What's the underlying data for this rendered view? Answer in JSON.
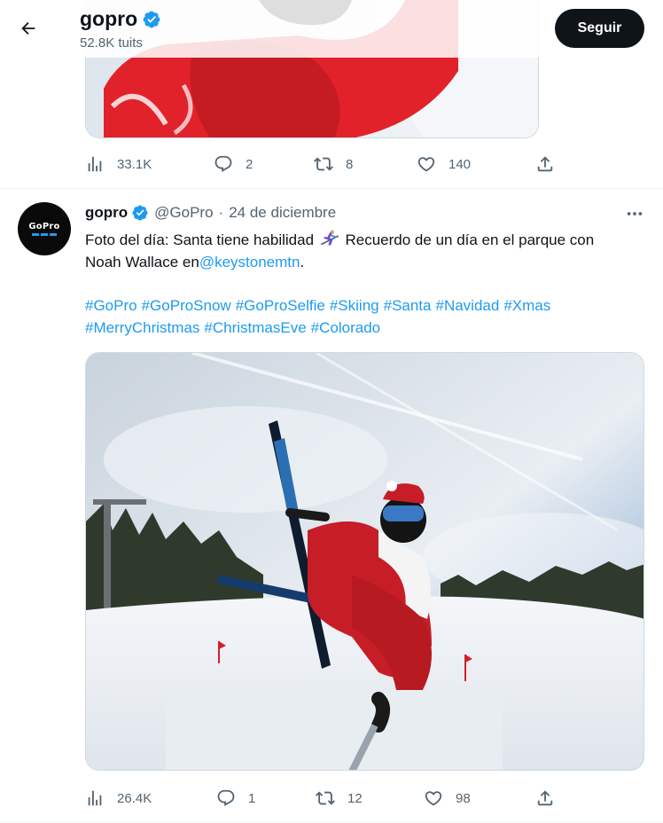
{
  "header": {
    "name": "gopro",
    "tweet_count": "52.8K tuits",
    "follow_label": "Seguir"
  },
  "prev_tweet": {
    "stats": {
      "views": "33.1K",
      "replies": "2",
      "retweets": "8",
      "likes": "140"
    }
  },
  "tweet": {
    "name": "gopro",
    "handle": "@GoPro",
    "separator": "·",
    "date": "24 de diciembre",
    "avatar_text": "GoPro",
    "text_part1": "Foto del día: Santa tiene habilidad",
    "text_part2": "Recuerdo de un día en el parque con",
    "text_part3": "Noah Wallace en",
    "mention": "@keystonemtn",
    "text_end": ".",
    "hashtags_row1": [
      "#GoPro",
      "#GoProSnow",
      "#GoProSelfie",
      "#Skiing",
      "#Santa",
      "#Navidad",
      "#Xmas"
    ],
    "hashtags_row2": [
      "#MerryChristmas",
      "#ChristmasEve",
      "#Colorado"
    ],
    "stats": {
      "views": "26.4K",
      "replies": "1",
      "retweets": "12",
      "likes": "98"
    }
  },
  "icons": {
    "back": "arrow-left-icon",
    "verified": "verified-badge-icon",
    "views": "bar-chart-icon",
    "reply": "speech-bubble-icon",
    "retweet": "retweet-icon",
    "like": "heart-icon",
    "share": "share-upload-icon",
    "more": "more-dots-icon"
  },
  "colors": {
    "accent": "#1d9bf0",
    "text": "#0f1419",
    "secondary": "#536471",
    "button_bg": "#0f1419"
  }
}
